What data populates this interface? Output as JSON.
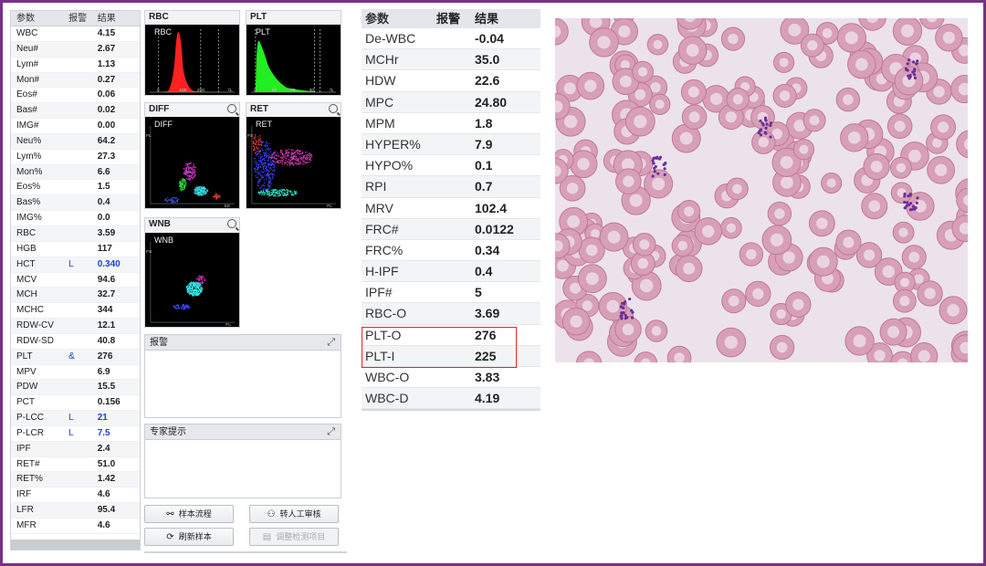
{
  "left_table": {
    "headers": [
      "参数",
      "报警",
      "结果"
    ],
    "rows": [
      {
        "name": "WBC",
        "flag": "",
        "value": "4.15"
      },
      {
        "name": "Neu#",
        "flag": "",
        "value": "2.67"
      },
      {
        "name": "Lym#",
        "flag": "",
        "value": "1.13"
      },
      {
        "name": "Mon#",
        "flag": "",
        "value": "0.27"
      },
      {
        "name": "Eos#",
        "flag": "",
        "value": "0.06"
      },
      {
        "name": "Bas#",
        "flag": "",
        "value": "0.02"
      },
      {
        "name": "IMG#",
        "flag": "",
        "value": "0.00"
      },
      {
        "name": "Neu%",
        "flag": "",
        "value": "64.2"
      },
      {
        "name": "Lym%",
        "flag": "",
        "value": "27.3"
      },
      {
        "name": "Mon%",
        "flag": "",
        "value": "6.6"
      },
      {
        "name": "Eos%",
        "flag": "",
        "value": "1.5"
      },
      {
        "name": "Bas%",
        "flag": "",
        "value": "0.4"
      },
      {
        "name": "IMG%",
        "flag": "",
        "value": "0.0"
      },
      {
        "name": "RBC",
        "flag": "",
        "value": "3.59"
      },
      {
        "name": "HGB",
        "flag": "",
        "value": "117"
      },
      {
        "name": "HCT",
        "flag": "L",
        "value": "0.340"
      },
      {
        "name": "MCV",
        "flag": "",
        "value": "94.6"
      },
      {
        "name": "MCH",
        "flag": "",
        "value": "32.7"
      },
      {
        "name": "MCHC",
        "flag": "",
        "value": "344"
      },
      {
        "name": "RDW-CV",
        "flag": "",
        "value": "12.1"
      },
      {
        "name": "RDW-SD",
        "flag": "",
        "value": "40.8"
      },
      {
        "name": "PLT",
        "flag": "&",
        "value": "276"
      },
      {
        "name": "MPV",
        "flag": "",
        "value": "6.9"
      },
      {
        "name": "PDW",
        "flag": "",
        "value": "15.5"
      },
      {
        "name": "PCT",
        "flag": "",
        "value": "0.156"
      },
      {
        "name": "P-LCC",
        "flag": "L",
        "value": "21"
      },
      {
        "name": "P-LCR",
        "flag": "L",
        "value": "7.5"
      },
      {
        "name": "IPF",
        "flag": "",
        "value": "2.4"
      },
      {
        "name": "RET#",
        "flag": "",
        "value": "51.0"
      },
      {
        "name": "RET%",
        "flag": "",
        "value": "1.42"
      },
      {
        "name": "IRF",
        "flag": "",
        "value": "4.6"
      },
      {
        "name": "LFR",
        "flag": "",
        "value": "95.4"
      },
      {
        "name": "MFR",
        "flag": "",
        "value": "4.6"
      }
    ]
  },
  "panels": {
    "rbc": {
      "title": "RBC",
      "inner": "RBC",
      "ticks": [
        "0",
        "100",
        "200",
        "fL"
      ]
    },
    "plt": {
      "title": "PLT",
      "inner": "PLT",
      "ticks": [
        "0",
        "10",
        "20",
        "30",
        "fL"
      ]
    },
    "diff": {
      "title": "DIFF",
      "inner": "DIFF",
      "axis_x": "SS",
      "axis_y": "FL"
    },
    "ret": {
      "title": "RET",
      "inner": "RET",
      "axis_x": "FL",
      "axis_y": "FS"
    },
    "wnb": {
      "title": "WNB",
      "inner": "WNB",
      "axis_x": "FL",
      "axis_y": "FS"
    }
  },
  "alarm_box": {
    "title": "报警"
  },
  "expert_box": {
    "title": "专家提示"
  },
  "buttons": {
    "sample_flow": "样本流程",
    "manual_review": "转人工审核",
    "refresh_sample": "刷新样本",
    "adjust_items": "调整检测项目"
  },
  "right_table": {
    "headers": [
      "参数",
      "报警",
      "结果"
    ],
    "rows": [
      {
        "name": "De-WBC",
        "flag": "",
        "value": "-0.04"
      },
      {
        "name": "MCHr",
        "flag": "",
        "value": "35.0"
      },
      {
        "name": "HDW",
        "flag": "",
        "value": "22.6"
      },
      {
        "name": "MPC",
        "flag": "",
        "value": "24.80"
      },
      {
        "name": "MPM",
        "flag": "",
        "value": "1.8"
      },
      {
        "name": "HYPER%",
        "flag": "",
        "value": "7.9"
      },
      {
        "name": "HYPO%",
        "flag": "",
        "value": "0.1"
      },
      {
        "name": "RPI",
        "flag": "",
        "value": "0.7"
      },
      {
        "name": "MRV",
        "flag": "",
        "value": "102.4"
      },
      {
        "name": "FRC#",
        "flag": "",
        "value": "0.0122"
      },
      {
        "name": "FRC%",
        "flag": "",
        "value": "0.34"
      },
      {
        "name": "H-IPF",
        "flag": "",
        "value": "0.4"
      },
      {
        "name": "IPF#",
        "flag": "",
        "value": "5"
      },
      {
        "name": "RBC-O",
        "flag": "",
        "value": "3.69"
      },
      {
        "name": "PLT-O",
        "flag": "",
        "value": "276"
      },
      {
        "name": "PLT-I",
        "flag": "",
        "value": "225"
      },
      {
        "name": "WBC-O",
        "flag": "",
        "value": "3.83"
      },
      {
        "name": "WBC-D",
        "flag": "",
        "value": "4.19"
      }
    ]
  },
  "colors": {
    "frame": "#7a2f86",
    "highlight": "#e5262a",
    "flag_value": "#1d3fd0",
    "rbc_curve": "#ff2020",
    "plt_curve": "#22ee22"
  }
}
